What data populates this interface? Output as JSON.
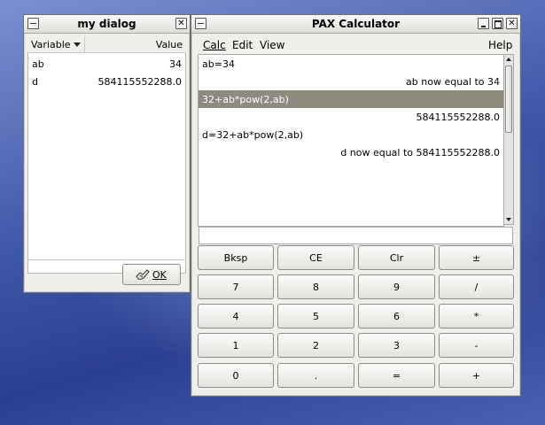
{
  "dialog": {
    "title": "my dialog",
    "close_glyph": "✕",
    "columns": {
      "variable": "Variable",
      "value": "Value"
    },
    "rows": [
      {
        "name": "ab",
        "value": "34"
      },
      {
        "name": "d",
        "value": "584115552288.0"
      }
    ],
    "ok_label": "OK"
  },
  "calculator": {
    "title": "PAX Calculator",
    "menu": {
      "calc": "Calc",
      "edit": "Edit",
      "view": "View",
      "help": "Help"
    },
    "display_lines": [
      {
        "text": "ab=34",
        "align": "left",
        "selected": false
      },
      {
        "text": "ab now equal to 34",
        "align": "right",
        "selected": false
      },
      {
        "text": "32+ab*pow(2,ab)",
        "align": "left",
        "selected": true
      },
      {
        "text": "584115552288.0",
        "align": "right",
        "selected": false
      },
      {
        "text": "d=32+ab*pow(2,ab)",
        "align": "left",
        "selected": false
      },
      {
        "text": "d now equal to 584115552288.0",
        "align": "right",
        "selected": false
      }
    ],
    "entry_value": "",
    "keys": [
      [
        "Bksp",
        "CE",
        "Clr",
        "±"
      ],
      [
        "7",
        "8",
        "9",
        "/"
      ],
      [
        "4",
        "5",
        "6",
        "*"
      ],
      [
        "1",
        "2",
        "3",
        "-"
      ],
      [
        "0",
        ".",
        "=",
        "+"
      ]
    ]
  },
  "icons": {
    "close": "close-icon",
    "minimize": "minimize-icon",
    "maximize": "maximize-icon",
    "dropdown": "chevron-down-icon",
    "ok": "ok-hand-icon"
  }
}
